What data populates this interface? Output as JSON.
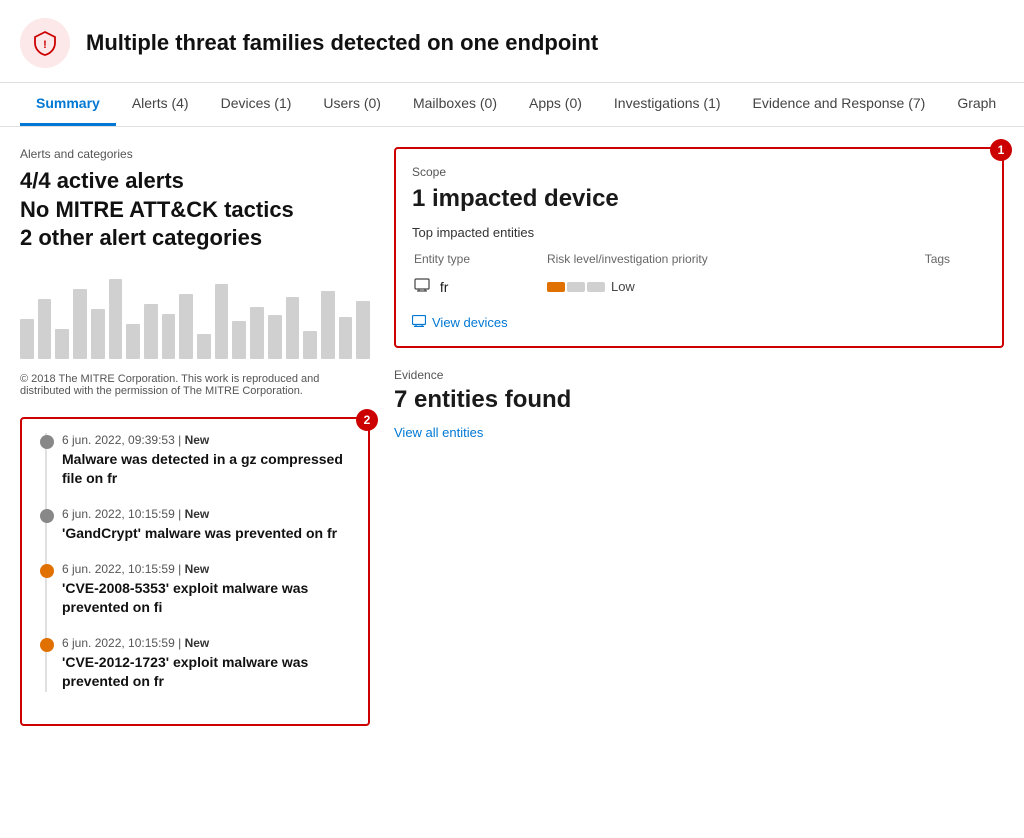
{
  "header": {
    "title": "Multiple threat families detected on one endpoint"
  },
  "nav": {
    "tabs": [
      {
        "label": "Summary",
        "active": true
      },
      {
        "label": "Alerts (4)",
        "active": false
      },
      {
        "label": "Devices (1)",
        "active": false
      },
      {
        "label": "Users (0)",
        "active": false
      },
      {
        "label": "Mailboxes (0)",
        "active": false
      },
      {
        "label": "Apps (0)",
        "active": false
      },
      {
        "label": "Investigations (1)",
        "active": false
      },
      {
        "label": "Evidence and Response (7)",
        "active": false
      },
      {
        "label": "Graph",
        "active": false
      }
    ]
  },
  "alerts_section": {
    "label": "Alerts and categories",
    "stats": [
      "4/4 active alerts",
      "No MITRE ATT&CK tactics",
      "2 other alert categories"
    ]
  },
  "scope": {
    "label": "Scope",
    "count": "1 impacted device",
    "badge": "1",
    "top_entities_label": "Top impacted entities",
    "columns": [
      "Entity type",
      "Risk level/investigation priority",
      "Tags"
    ],
    "entity_name": "fr",
    "risk_label": "Low",
    "view_devices_label": "View devices"
  },
  "evidence": {
    "label": "Evidence",
    "count": "7 entities found",
    "view_all_label": "View all entities"
  },
  "timeline": {
    "badge": "2",
    "items": [
      {
        "dot": "gray",
        "meta": "6 jun. 2022, 09:39:53 | New",
        "title": "Malware was detected in a gz compressed file on fr"
      },
      {
        "dot": "gray",
        "meta": "6 jun. 2022, 10:15:59 | New",
        "title": "'GandCrypt' malware was prevented on fr"
      },
      {
        "dot": "orange",
        "meta": "6 jun. 2022, 10:15:59 | New",
        "title": "'CVE-2008-5353' exploit malware was prevented on fi"
      },
      {
        "dot": "orange",
        "meta": "6 jun. 2022, 10:15:59 | New",
        "title": "'CVE-2012-1723' exploit malware was prevented on fr"
      }
    ]
  },
  "bars": [
    40,
    60,
    30,
    70,
    50,
    80,
    35,
    55,
    45,
    65,
    25,
    75,
    38,
    52,
    44,
    62,
    28,
    68,
    42,
    58
  ]
}
